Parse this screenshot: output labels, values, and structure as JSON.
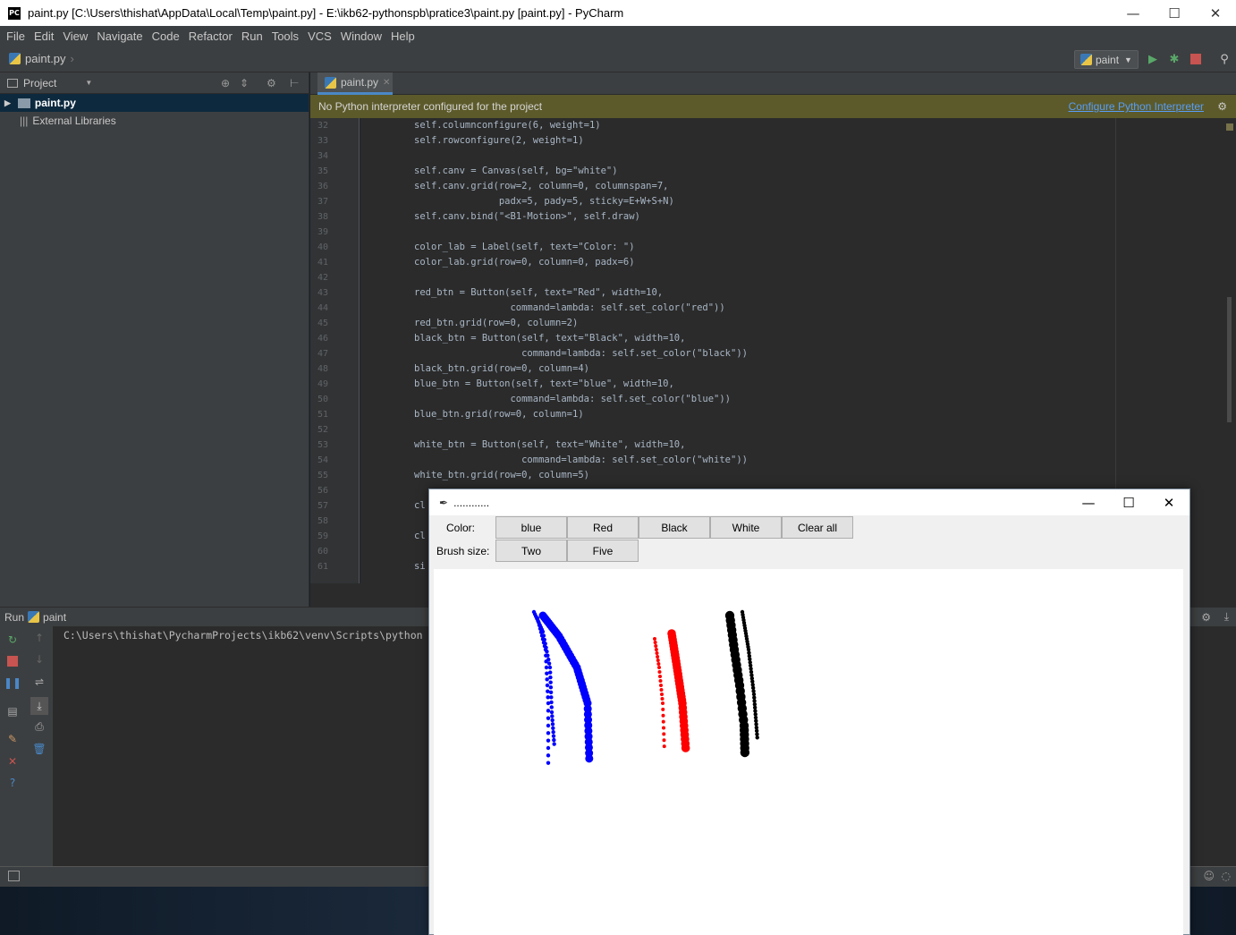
{
  "window": {
    "title": "paint.py [C:\\Users\\thishat\\AppData\\Local\\Temp\\paint.py] - E:\\ikb62-pythonspb\\pratice3\\paint.py [paint.py] - PyCharm",
    "logo": "PC",
    "minimize": "—",
    "maximize": "☐",
    "close": "✕"
  },
  "menu": [
    "File",
    "Edit",
    "View",
    "Navigate",
    "Code",
    "Refactor",
    "Run",
    "Tools",
    "VCS",
    "Window",
    "Help"
  ],
  "navbar": {
    "breadcrumb": "paint.py",
    "run_config": "paint"
  },
  "project": {
    "title": "Project",
    "items": [
      {
        "label": "paint.py",
        "selected": true
      },
      {
        "label": "External Libraries",
        "selected": false
      }
    ]
  },
  "editor": {
    "tab_label": "paint.py",
    "banner": "No Python interpreter configured for the project",
    "banner_link": "Configure Python Interpreter",
    "lines": [
      {
        "n": "32",
        "text": "self.columnconfigure(6, weight=1)"
      },
      {
        "n": "33",
        "text": "self.rowconfigure(2, weight=1)"
      },
      {
        "n": "34",
        "text": ""
      },
      {
        "n": "35",
        "text": "self.canv = Canvas(self, bg=\"white\")"
      },
      {
        "n": "36",
        "text": "self.canv.grid(row=2, column=0, columnspan=7,"
      },
      {
        "n": "37",
        "text": "               padx=5, pady=5, sticky=E+W+S+N)"
      },
      {
        "n": "38",
        "text": "self.canv.bind(\"<B1-Motion>\", self.draw)"
      },
      {
        "n": "39",
        "text": ""
      },
      {
        "n": "40",
        "text": "color_lab = Label(self, text=\"Color: \")"
      },
      {
        "n": "41",
        "text": "color_lab.grid(row=0, column=0, padx=6)"
      },
      {
        "n": "42",
        "text": ""
      },
      {
        "n": "43",
        "text": "red_btn = Button(self, text=\"Red\", width=10,"
      },
      {
        "n": "44",
        "text": "                 command=lambda: self.set_color(\"red\"))"
      },
      {
        "n": "45",
        "text": "red_btn.grid(row=0, column=2)"
      },
      {
        "n": "46",
        "text": "black_btn = Button(self, text=\"Black\", width=10,"
      },
      {
        "n": "47",
        "text": "                   command=lambda: self.set_color(\"black\"))"
      },
      {
        "n": "48",
        "text": "black_btn.grid(row=0, column=4)"
      },
      {
        "n": "49",
        "text": "blue_btn = Button(self, text=\"blue\", width=10,"
      },
      {
        "n": "50",
        "text": "                 command=lambda: self.set_color(\"blue\"))"
      },
      {
        "n": "51",
        "text": "blue_btn.grid(row=0, column=1)"
      },
      {
        "n": "52",
        "text": ""
      },
      {
        "n": "53",
        "text": "white_btn = Button(self, text=\"White\", width=10,"
      },
      {
        "n": "54",
        "text": "                   command=lambda: self.set_color(\"white\"))"
      },
      {
        "n": "55",
        "text": "white_btn.grid(row=0, column=5)"
      },
      {
        "n": "56",
        "text": ""
      },
      {
        "n": "57",
        "text": "cl"
      },
      {
        "n": "58",
        "text": ""
      },
      {
        "n": "59",
        "text": "cl"
      },
      {
        "n": "60",
        "text": ""
      },
      {
        "n": "61",
        "text": "si"
      }
    ]
  },
  "run": {
    "label": "Run",
    "config": "paint",
    "console_line": "C:\\Users\\thishat\\PycharmProjects\\ikb62\\venv\\Scripts\\python"
  },
  "tk": {
    "title": "............",
    "color_label": "Color:",
    "brush_label": "Brush size:",
    "color_buttons": [
      "blue",
      "Red",
      "Black",
      "White",
      "Clear all"
    ],
    "brush_buttons": [
      "Two",
      "Five"
    ]
  },
  "colors": {
    "accent_link": "#589df6",
    "banner_bg": "#5c5a2a",
    "stroke_blue": "#0000ff",
    "stroke_red": "#ff0000",
    "stroke_black": "#000000"
  },
  "icons": {
    "run": "play-icon",
    "debug": "bug-icon",
    "stop": "stop-icon",
    "search": "search-icon"
  }
}
